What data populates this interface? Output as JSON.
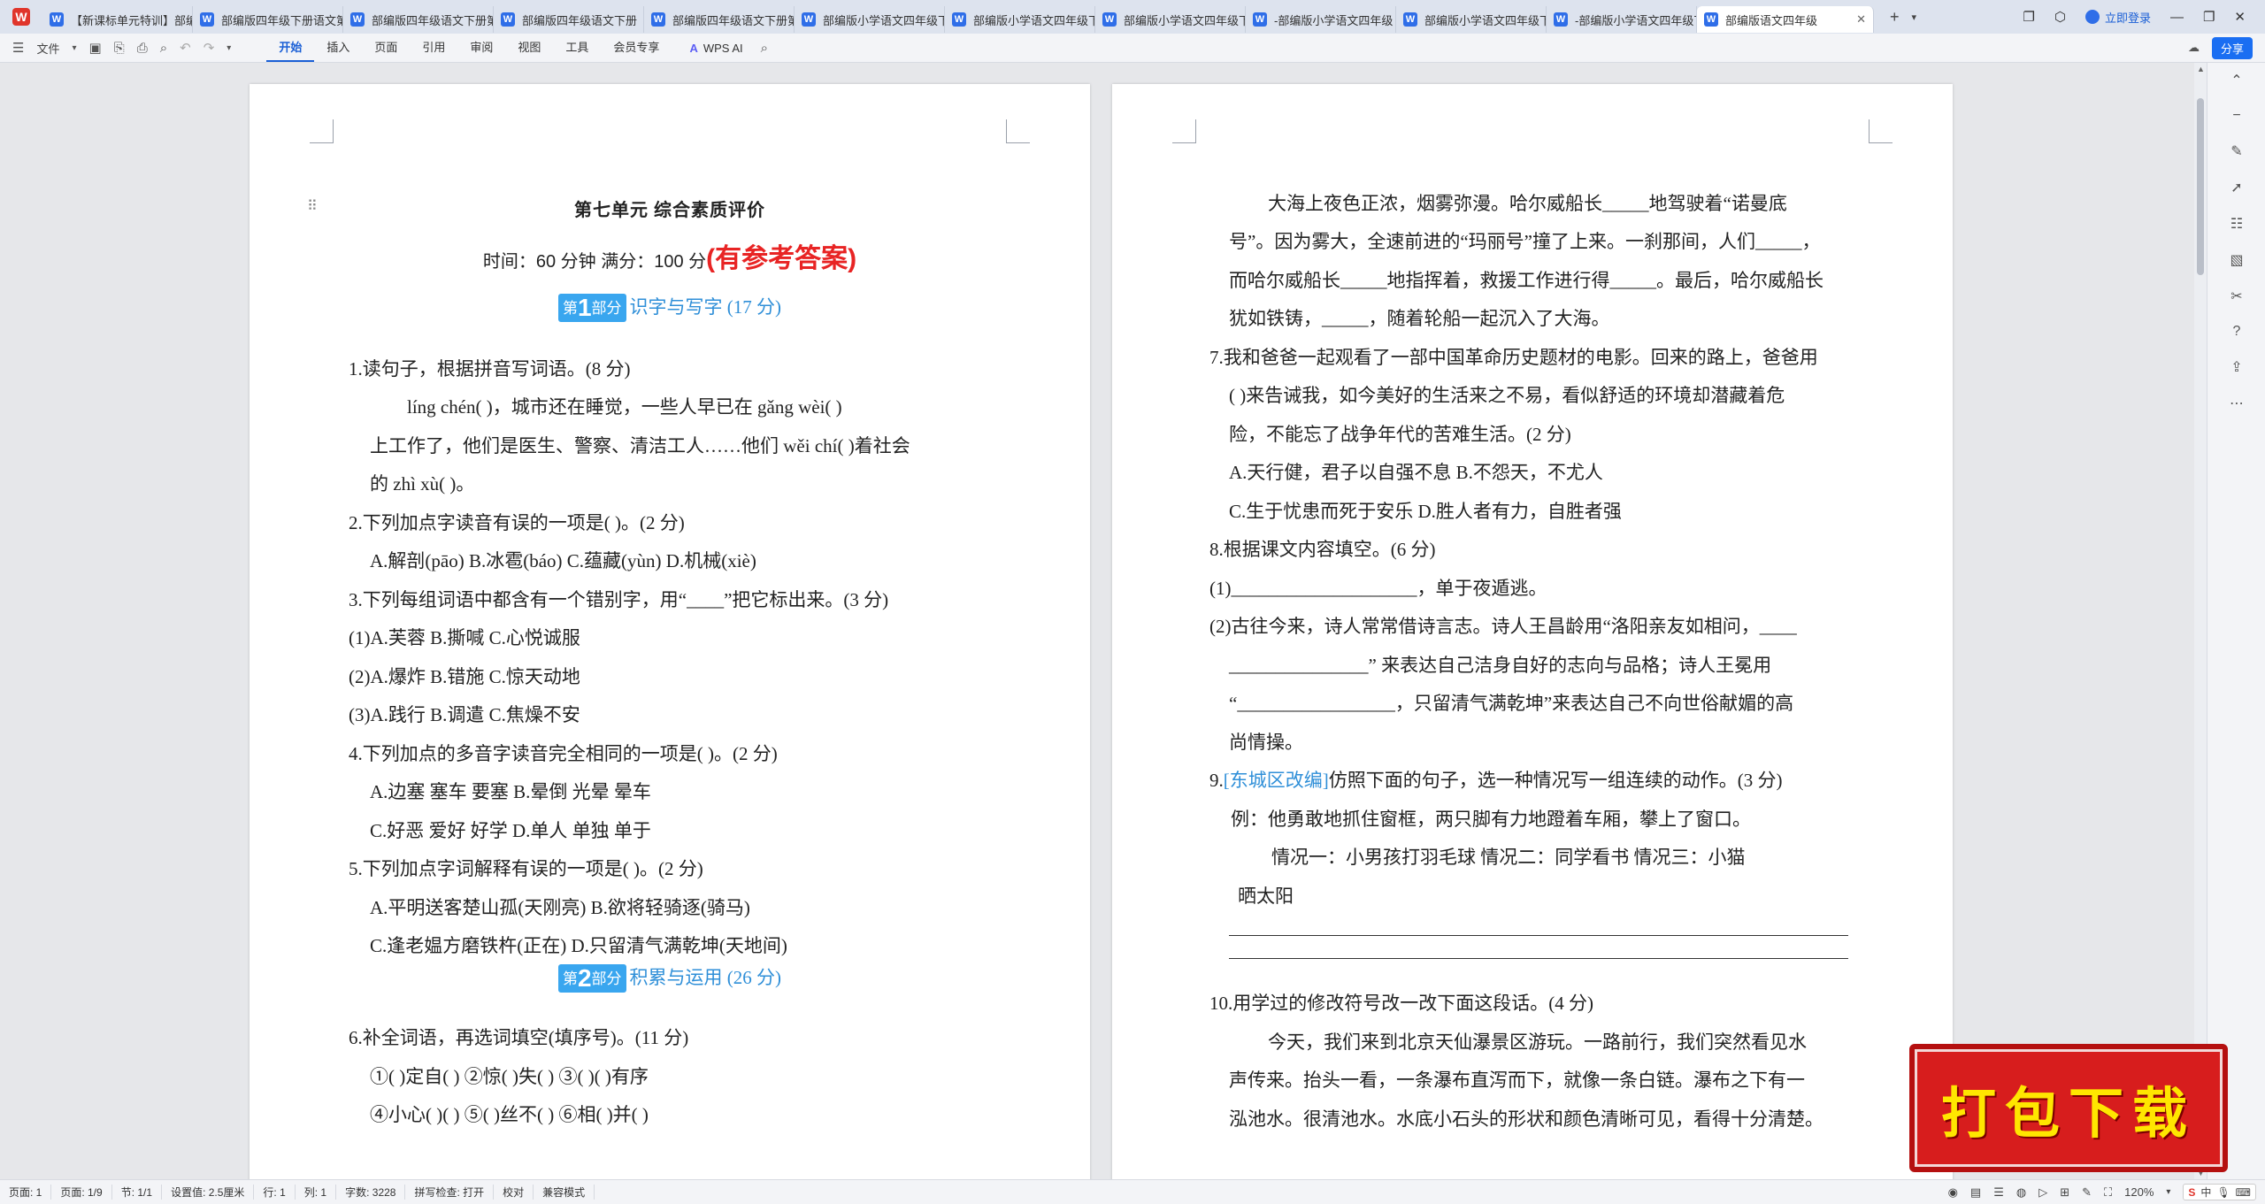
{
  "tabs": [
    "【新课标单元特训】部编",
    "部编版四年级下册语文第",
    "部编版四年级语文下册第",
    "部编版四年级语文下册",
    "部编版四年级语文下册第",
    "部编版小学语文四年级下",
    "部编版小学语文四年级下",
    "部编版小学语文四年级下",
    "-部编版小学语文四年级",
    "部编版小学语文四年级下",
    "-部编版小学语文四年级下",
    "部编版语文四年级"
  ],
  "window": {
    "login": "立即登录"
  },
  "ribbon": {
    "file_label": "文件",
    "menu": [
      "开始",
      "插入",
      "页面",
      "引用",
      "审阅",
      "视图",
      "工具",
      "会员专享"
    ],
    "active_menu": "开始",
    "wps_ai": "WPS AI",
    "share": "分享"
  },
  "page1": {
    "title": "第七单元  综合素质评价",
    "meta": "时间：60 分钟    满分：100 分",
    "answer_note": "(有参考答案)",
    "sec1": {
      "badge_pre": "第",
      "badge_num": "1",
      "badge_post": "部分",
      "text": "识字与写字   (17 分)"
    },
    "lines": [
      "1.读句子，根据拼音写词语。(8 分)",
      "líng chén(          )，城市还在睡觉，一些人早已在 gǎng wèi(          )",
      "上工作了，他们是医生、警察、清洁工人……他们 wěi chí(          )着社会",
      "的 zhì xù(          )。",
      "2.下列加点字读音有误的一项是(      )。(2 分)",
      "A.解剖(pāo)    B.冰雹(báo)    C.蕴藏(yùn)    D.机械(xiè)",
      "3.下列每组词语中都含有一个错别字，用“____”把它标出来。(3 分)",
      "(1)A.芙蓉              B.撕喊               C.心悦诚服",
      "(2)A.爆炸              B.错施               C.惊天动地",
      "(3)A.践行              B.调遣               C.焦燥不安",
      "4.下列加点的多音字读音完全相同的一项是(      )。(2 分)",
      "A.边塞    塞车    要塞              B.晕倒    光晕    晕车",
      "C.好恶    爱好    好学              D.单人    单独    单于",
      "5.下列加点字词解释有误的一项是(      )。(2 分)",
      "A.平明送客楚山孤(天刚亮)  B.欲将轻骑逐(骑马)",
      "C.逢老媪方磨铁杵(正在)      D.只留清气满乾坤(天地间)"
    ],
    "sec2": {
      "badge_pre": "第",
      "badge_num": "2",
      "badge_post": "部分",
      "text": "积累与运用   (26 分)"
    },
    "lines2": [
      "6.补全词语，再选词填空(填序号)。(11 分)",
      "①(    )定自(    )        ②惊(    )失(    )        ③(    )(    )有序",
      "④小心(    )(    )        ⑤(    )丝不(    )        ⑥相(    )并(    )"
    ]
  },
  "page2": {
    "lines": [
      "大海上夜色正浓，烟雾弥漫。哈尔威船长_____地驾驶着“诺曼底",
      "号”。因为雾大，全速前进的“玛丽号”撞了上来。一刹那间，人们_____，",
      "而哈尔威船长_____地指挥着，救援工作进行得_____。最后，哈尔威船长",
      "犹如铁铸，_____，随着轮船一起沉入了大海。",
      "7.我和爸爸一起观看了一部中国革命历史题材的电影。回来的路上，爸爸用",
      "(      )来告诫我，如今美好的生活来之不易，看似舒适的环境却潜藏着危",
      "险，不能忘了战争年代的苦难生活。(2 分)",
      "A.天行健，君子以自强不息          B.不怨天，不尤人",
      "C.生于忧患而死于安乐              D.胜人者有力，自胜者强",
      "8.根据课文内容填空。(6 分)",
      "(1)____________________，单于夜遁逃。",
      "(2)古往今来，诗人常常借诗言志。诗人王昌龄用“洛阳亲友如相问，____",
      "_______________” 来表达自己洁身自好的志向与品格；诗人王冕用",
      "“_________________，只留清气满乾坤”来表达自己不向世俗献媚的高",
      "尚情操。"
    ],
    "q9_num": "9.",
    "q9_src": "[东城区改编]",
    "q9_rest": "仿照下面的句子，选一种情况写一组连续的动作。(3 分)",
    "lines3": [
      "例：他勇敢地抓住窗框，两只脚有力地蹬着车厢，攀上了窗口。",
      "情况一：小男孩打羽毛球        情况二：同学看书        情况三：小猫",
      "晒太阳",
      "10.用学过的修改符号改一改下面这段话。(4 分)",
      "今天，我们来到北京天仙瀑景区游玩。一路前行，我们突然看见水",
      "声传来。抬头一看，一条瀑布直泻而下，就像一条白链。瀑布之下有一",
      "泓池水。很清池水。水底小石头的形状和颜色清晰可见，看得十分清楚。"
    ]
  },
  "status": {
    "items": [
      "页面: 1",
      "页面: 1/9",
      "节: 1/1",
      "设置值: 2.5厘米",
      "行: 1",
      "列: 1",
      "字数: 3228",
      "拼写检查: 打开",
      "校对",
      "兼容模式"
    ],
    "zoom": "120%",
    "ime": "中"
  },
  "banner": {
    "text": "打包下载"
  }
}
